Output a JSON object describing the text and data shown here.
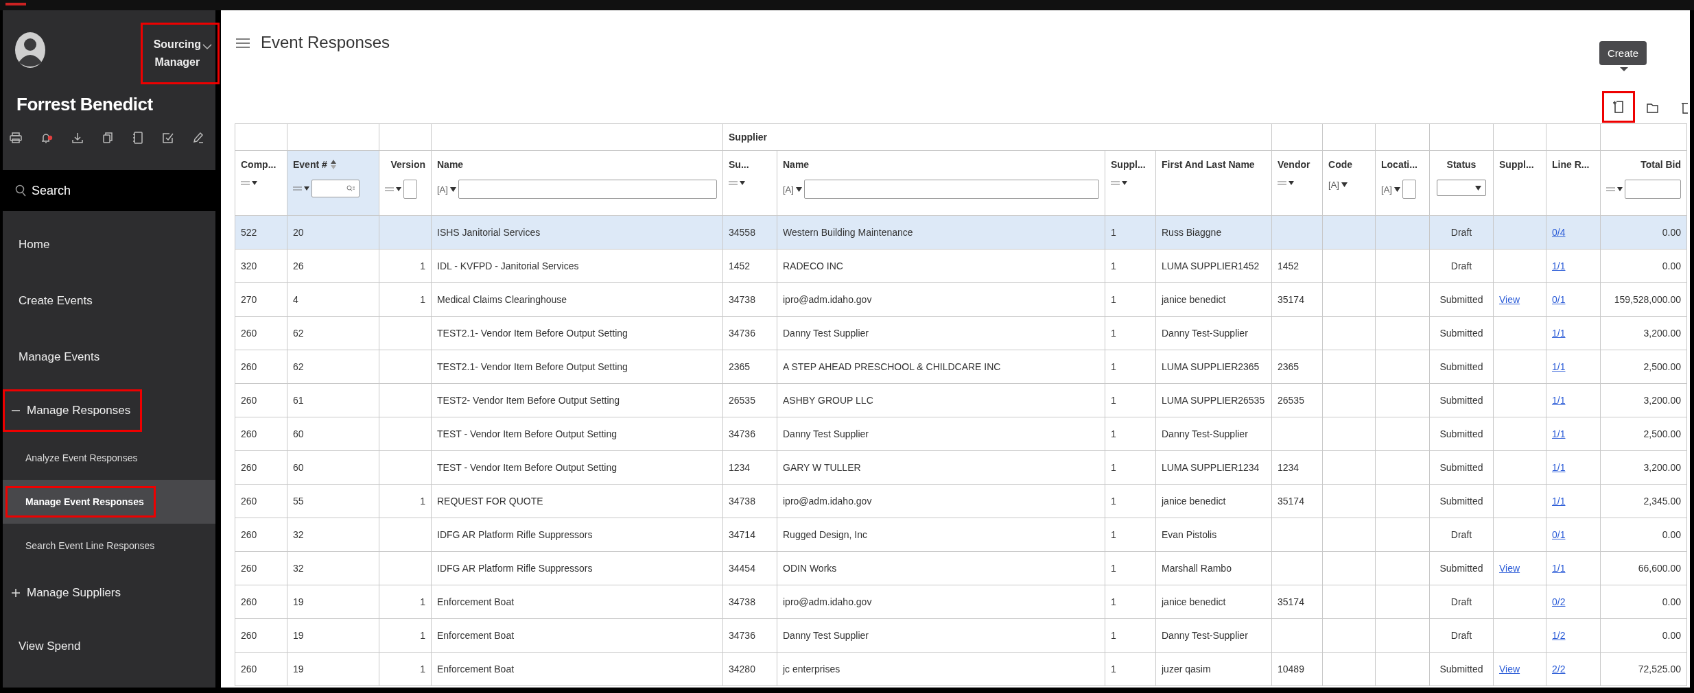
{
  "user": {
    "name": "Forrest Benedict",
    "role_lines": [
      "Sourcing",
      "Manager"
    ],
    "role_highlighted": true
  },
  "sidebar": {
    "search_label": "Search",
    "items": [
      {
        "label": "Home",
        "kind": "link",
        "selected": false,
        "highlighted": false
      },
      {
        "label": "Create Events",
        "kind": "link",
        "selected": false,
        "highlighted": false
      },
      {
        "label": "Manage Events",
        "kind": "link",
        "selected": false,
        "highlighted": false
      },
      {
        "label": "Manage Responses",
        "kind": "group",
        "expanded": true,
        "selected": false,
        "highlighted": true,
        "children": [
          {
            "label": "Analyze Event Responses",
            "selected": false,
            "highlighted": false
          },
          {
            "label": "Manage Event Responses",
            "selected": true,
            "highlighted": true
          },
          {
            "label": "Search Event Line Responses",
            "selected": false,
            "highlighted": false
          }
        ]
      },
      {
        "label": "Manage Suppliers",
        "kind": "group",
        "expanded": false,
        "selected": false,
        "highlighted": false
      },
      {
        "label": "View Spend",
        "kind": "link",
        "selected": false,
        "highlighted": false
      }
    ]
  },
  "page": {
    "title": "Event Responses",
    "tooltip": "Create",
    "create_highlighted": true
  },
  "table": {
    "column_group": {
      "label": "Supplier"
    },
    "columns": [
      {
        "label": "Comp...",
        "kind": "operator",
        "grouped": false,
        "sorted": false
      },
      {
        "label": "Event #",
        "kind": "opsearch",
        "grouped": false,
        "sorted": true
      },
      {
        "label": "Version",
        "kind": "opinput",
        "grouped": false,
        "sorted": false
      },
      {
        "label": "Name",
        "kind": "textinput",
        "filter_symbol": "[A]",
        "grouped": false,
        "sorted": false
      },
      {
        "label": "Su...",
        "kind": "operator",
        "grouped": true,
        "sorted": false
      },
      {
        "label": "Name",
        "kind": "textinput",
        "filter_symbol": "[A]",
        "grouped": true,
        "sorted": false
      },
      {
        "label": "Suppl...",
        "kind": "operator",
        "grouped": true,
        "sorted": false
      },
      {
        "label": "First And Last Name",
        "kind": "plain",
        "grouped": true,
        "sorted": false
      },
      {
        "label": "Vendor",
        "kind": "operator",
        "grouped": false,
        "sorted": false
      },
      {
        "label": "Code",
        "kind": "text",
        "filter_symbol": "[A]",
        "grouped": false,
        "sorted": false
      },
      {
        "label": "Locati...",
        "kind": "textinput",
        "filter_symbol": "[A]",
        "grouped": false,
        "sorted": false
      },
      {
        "label": "Status",
        "kind": "select",
        "grouped": false,
        "sorted": false
      },
      {
        "label": "Suppl...",
        "kind": "plain",
        "grouped": false,
        "sorted": false
      },
      {
        "label": "Line R...",
        "kind": "plain",
        "grouped": false,
        "sorted": false
      },
      {
        "label": "Total Bid",
        "kind": "opinput",
        "grouped": false,
        "sorted": false
      }
    ],
    "rows": [
      {
        "selected": true,
        "cells": [
          "522",
          "20",
          null,
          "ISHS Janitorial Services",
          "34558",
          "Western Building Maintenance",
          "1",
          "Russ Biaggne",
          null,
          null,
          null,
          "Draft",
          null,
          {
            "link": "0/4"
          },
          "0.00"
        ]
      },
      {
        "selected": false,
        "cells": [
          "320",
          "26",
          "1",
          "IDL - KVFPD - Janitorial Services",
          "1452",
          "RADECO INC",
          "1",
          "LUMA SUPPLIER1452",
          "1452",
          null,
          null,
          "Draft",
          null,
          {
            "link": "1/1"
          },
          "0.00"
        ]
      },
      {
        "selected": false,
        "cells": [
          "270",
          "4",
          "1",
          "Medical Claims Clearinghouse",
          "34738",
          "ipro@adm.idaho.gov",
          "1",
          "janice benedict",
          "35174",
          null,
          null,
          "Submitted",
          {
            "link": "View"
          },
          {
            "link": "0/1"
          },
          "159,528,000.00"
        ]
      },
      {
        "selected": false,
        "cells": [
          "260",
          "62",
          null,
          "TEST2.1- Vendor Item Before Output Setting",
          "34736",
          "Danny Test Supplier",
          "1",
          "Danny Test-Supplier",
          null,
          null,
          null,
          "Submitted",
          null,
          {
            "link": "1/1"
          },
          "3,200.00"
        ]
      },
      {
        "selected": false,
        "cells": [
          "260",
          "62",
          null,
          "TEST2.1- Vendor Item Before Output Setting",
          "2365",
          "A STEP AHEAD PRESCHOOL & CHILDCARE INC",
          "1",
          "LUMA SUPPLIER2365",
          "2365",
          null,
          null,
          "Submitted",
          null,
          {
            "link": "1/1"
          },
          "2,500.00"
        ]
      },
      {
        "selected": false,
        "cells": [
          "260",
          "61",
          null,
          "TEST2- Vendor Item Before Output Setting",
          "26535",
          "ASHBY GROUP LLC",
          "1",
          "LUMA SUPPLIER26535",
          "26535",
          null,
          null,
          "Submitted",
          null,
          {
            "link": "1/1"
          },
          "3,200.00"
        ]
      },
      {
        "selected": false,
        "cells": [
          "260",
          "60",
          null,
          "TEST - Vendor Item Before Output Setting",
          "34736",
          "Danny Test Supplier",
          "1",
          "Danny Test-Supplier",
          null,
          null,
          null,
          "Submitted",
          null,
          {
            "link": "1/1"
          },
          "2,500.00"
        ]
      },
      {
        "selected": false,
        "cells": [
          "260",
          "60",
          null,
          "TEST - Vendor Item Before Output Setting",
          "1234",
          "GARY W TULLER",
          "1",
          "LUMA SUPPLIER1234",
          "1234",
          null,
          null,
          "Submitted",
          null,
          {
            "link": "1/1"
          },
          "3,200.00"
        ]
      },
      {
        "selected": false,
        "cells": [
          "260",
          "55",
          "1",
          "REQUEST FOR QUOTE",
          "34738",
          "ipro@adm.idaho.gov",
          "1",
          "janice benedict",
          "35174",
          null,
          null,
          "Submitted",
          null,
          {
            "link": "1/1"
          },
          "2,345.00"
        ]
      },
      {
        "selected": false,
        "cells": [
          "260",
          "32",
          null,
          "IDFG AR Platform Rifle Suppressors",
          "34714",
          "Rugged Design, Inc",
          "1",
          "Evan Pistolis",
          null,
          null,
          null,
          "Draft",
          null,
          {
            "link": "0/1"
          },
          "0.00"
        ]
      },
      {
        "selected": false,
        "cells": [
          "260",
          "32",
          null,
          "IDFG AR Platform Rifle Suppressors",
          "34454",
          "ODIN Works",
          "1",
          "Marshall Rambo",
          null,
          null,
          null,
          "Submitted",
          {
            "link": "View"
          },
          {
            "link": "1/1"
          },
          "66,600.00"
        ]
      },
      {
        "selected": false,
        "cells": [
          "260",
          "19",
          "1",
          "Enforcement Boat",
          "34738",
          "ipro@adm.idaho.gov",
          "1",
          "janice benedict",
          "35174",
          null,
          null,
          "Draft",
          null,
          {
            "link": "0/2"
          },
          "0.00"
        ]
      },
      {
        "selected": false,
        "cells": [
          "260",
          "19",
          "1",
          "Enforcement Boat",
          "34736",
          "Danny Test Supplier",
          "1",
          "Danny Test-Supplier",
          null,
          null,
          null,
          "Draft",
          null,
          {
            "link": "1/2"
          },
          "0.00"
        ]
      },
      {
        "selected": false,
        "cells": [
          "260",
          "19",
          "1",
          "Enforcement Boat",
          "34280",
          "jc enterprises",
          "1",
          "juzer qasim",
          "10489",
          null,
          null,
          "Submitted",
          {
            "link": "View"
          },
          {
            "link": "2/2"
          },
          "72,525.00"
        ]
      }
    ]
  }
}
